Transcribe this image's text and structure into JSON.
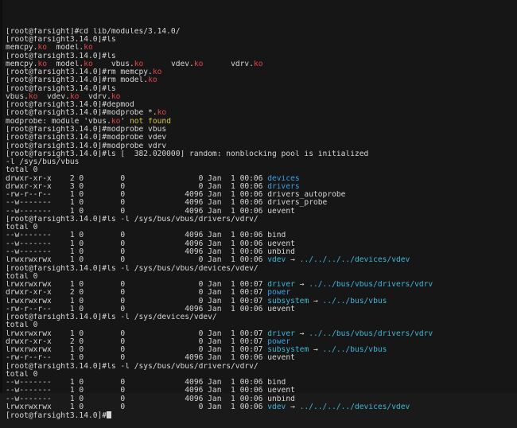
{
  "terminal": {
    "colors": {
      "background": "#161616",
      "text": "#d6d6d6",
      "module": "#e0464a",
      "directory": "#3aa0e6",
      "link": "#3fb7d8",
      "warning": "#d7c43a"
    },
    "lines": [
      [
        [
          "[root@farsight]#cd lib/modules/3.14.0/",
          "white"
        ]
      ],
      [
        [
          "[root@farsight3.14.0]#ls",
          "white"
        ]
      ],
      [
        [
          "memcpy.",
          "white"
        ],
        [
          "ko",
          "red"
        ],
        [
          "  model.",
          "white"
        ],
        [
          "ko",
          "red"
        ]
      ],
      [
        [
          "[root@farsight3.14.0]#ls",
          "white"
        ]
      ],
      [
        [
          "memcpy.",
          "white"
        ],
        [
          "ko",
          "red"
        ],
        [
          "  model.",
          "white"
        ],
        [
          "ko",
          "red"
        ],
        [
          "    vbus.",
          "white"
        ],
        [
          "ko",
          "red"
        ],
        [
          "      vdev.",
          "white"
        ],
        [
          "ko",
          "red"
        ],
        [
          "      vdrv.",
          "white"
        ],
        [
          "ko",
          "red"
        ]
      ],
      [
        [
          "[root@farsight3.14.0]#rm memcpy.",
          "white"
        ],
        [
          "ko",
          "red"
        ]
      ],
      [
        [
          "[root@farsight3.14.0]#rm model.",
          "white"
        ],
        [
          "ko",
          "red"
        ]
      ],
      [
        [
          "[root@farsight3.14.0]#ls",
          "white"
        ]
      ],
      [
        [
          "vbus.",
          "white"
        ],
        [
          "ko",
          "red"
        ],
        [
          "  vdev.",
          "white"
        ],
        [
          "ko",
          "red"
        ],
        [
          "  vdrv.",
          "white"
        ],
        [
          "ko",
          "red"
        ]
      ],
      [
        [
          "[root@farsight3.14.0]#depmod",
          "white"
        ]
      ],
      [
        [
          "[root@farsight3.14.0]#modprobe *.",
          "white"
        ],
        [
          "ko",
          "red"
        ]
      ],
      [
        [
          "modprobe: module 'vbus.",
          "white"
        ],
        [
          "ko",
          "red"
        ],
        [
          "' ",
          "white"
        ],
        [
          "not found",
          "yellow"
        ]
      ],
      [
        [
          "[root@farsight3.14.0]#modprobe vbus",
          "white"
        ]
      ],
      [
        [
          "[root@farsight3.14.0]#modprobe vdev",
          "white"
        ]
      ],
      [
        [
          "[root@farsight3.14.0]#modprobe vdrv",
          "white"
        ]
      ],
      [
        [
          "[root@farsight3.14.0]#ls [  382.020000] random: nonblocking pool is initialized",
          "white"
        ]
      ],
      [
        [
          "-l /sys/bus/vbus",
          "white"
        ]
      ],
      [
        [
          "total 0",
          "white"
        ]
      ],
      [
        [
          "drwxr-xr-x    2 0        0                0 Jan  1 00:06 ",
          "white"
        ],
        [
          "devices",
          "blue"
        ]
      ],
      [
        [
          "drwxr-xr-x    3 0        0                0 Jan  1 00:06 ",
          "white"
        ],
        [
          "drivers",
          "blue"
        ]
      ],
      [
        [
          "-rw-r--r--    1 0        0             4096 Jan  1 00:06 drivers_autoprobe",
          "white"
        ]
      ],
      [
        [
          "--w-------    1 0        0             4096 Jan  1 00:06 drivers_probe",
          "white"
        ]
      ],
      [
        [
          "--w-------    1 0        0             4096 Jan  1 00:06 uevent",
          "white"
        ]
      ],
      [
        [
          "[root@farsight3.14.0]#ls -l /sys/bus/vbus/drivers/vdrv/",
          "white"
        ]
      ],
      [
        [
          "total 0",
          "white"
        ]
      ],
      [
        [
          "--w-------    1 0        0             4096 Jan  1 00:06 bind",
          "white"
        ]
      ],
      [
        [
          "--w-------    1 0        0             4096 Jan  1 00:06 uevent",
          "white"
        ]
      ],
      [
        [
          "--w-------    1 0        0             4096 Jan  1 00:06 unbind",
          "white"
        ]
      ],
      [
        [
          "lrwxrwxrwx    1 0        0                0 Jan  1 00:06 ",
          "white"
        ],
        [
          "vdev",
          "cyan"
        ],
        [
          " → ",
          "white"
        ],
        [
          "../../../../devices/vdev",
          "cyan"
        ]
      ],
      [
        [
          "[root@farsight3.14.0]#ls -l /sys/bus/vbus/devices/vdev/",
          "white"
        ]
      ],
      [
        [
          "total 0",
          "white"
        ]
      ],
      [
        [
          "lrwxrwxrwx    1 0        0                0 Jan  1 00:07 ",
          "white"
        ],
        [
          "driver",
          "cyan"
        ],
        [
          " → ",
          "white"
        ],
        [
          "../../bus/vbus/drivers/vdrv",
          "cyan"
        ]
      ],
      [
        [
          "drwxr-xr-x    2 0        0                0 Jan  1 00:07 ",
          "white"
        ],
        [
          "power",
          "blue"
        ]
      ],
      [
        [
          "lrwxrwxrwx    1 0        0                0 Jan  1 00:07 ",
          "white"
        ],
        [
          "subsystem",
          "cyan"
        ],
        [
          " → ",
          "white"
        ],
        [
          "../../bus/vbus",
          "cyan"
        ]
      ],
      [
        [
          "-rw-r--r--    1 0        0             4096 Jan  1 00:06 uevent",
          "white"
        ]
      ],
      [
        [
          "[root@farsight3.14.0]#ls -l /sys/devices/vdev/",
          "white"
        ]
      ],
      [
        [
          "total 0",
          "white"
        ]
      ],
      [
        [
          "lrwxrwxrwx    1 0        0                0 Jan  1 00:07 ",
          "white"
        ],
        [
          "driver",
          "cyan"
        ],
        [
          " → ",
          "white"
        ],
        [
          "../../bus/vbus/drivers/vdrv",
          "cyan"
        ]
      ],
      [
        [
          "drwxr-xr-x    2 0        0                0 Jan  1 00:07 ",
          "white"
        ],
        [
          "power",
          "blue"
        ]
      ],
      [
        [
          "lrwxrwxrwx    1 0        0                0 Jan  1 00:07 ",
          "white"
        ],
        [
          "subsystem",
          "cyan"
        ],
        [
          " → ",
          "white"
        ],
        [
          "../../bus/vbus",
          "cyan"
        ]
      ],
      [
        [
          "-rw-r--r--    1 0        0             4096 Jan  1 00:06 uevent",
          "white"
        ]
      ],
      [
        [
          "[root@farsight3.14.0]#ls -l /sys/bus/vbus/drivers/vdrv/",
          "white"
        ]
      ],
      [
        [
          "total 0",
          "white"
        ]
      ],
      [
        [
          "--w-------    1 0        0             4096 Jan  1 00:06 bind",
          "white"
        ]
      ],
      [
        [
          "--w-------    1 0        0             4096 Jan  1 00:06 uevent",
          "white"
        ]
      ],
      [
        [
          "--w-------    1 0        0             4096 Jan  1 00:06 unbind",
          "white"
        ]
      ],
      [
        [
          "lrwxrwxrwx    1 0        0                0 Jan  1 00:06 ",
          "white"
        ],
        [
          "vdev",
          "cyan"
        ],
        [
          " → ",
          "white"
        ],
        [
          "../../../../devices/vdev",
          "cyan"
        ]
      ],
      [
        [
          "[root@farsight3.14.0]#",
          "white"
        ]
      ]
    ]
  }
}
